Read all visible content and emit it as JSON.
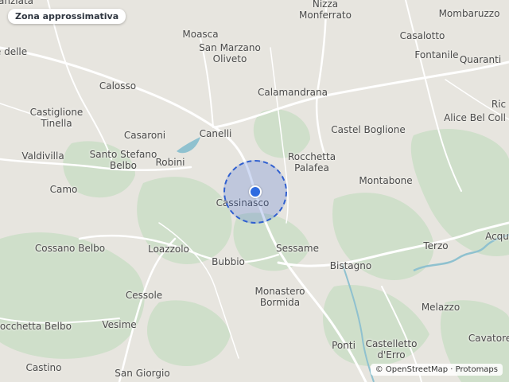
{
  "map": {
    "badge_label": "Zona approssimativa",
    "attribution": "© OpenStreetMap · Protomaps",
    "colors": {
      "land": "#e7e5df",
      "forest": "#c9dcc4",
      "road": "#ffffff",
      "water": "#8fc1cf",
      "marker": "#2f6be0",
      "radius_fill": "rgba(70,110,210,0.25)",
      "radius_stroke": "#2f5fd0"
    },
    "places": [
      {
        "name": "Nizza\nMonferrato"
      },
      {
        "name": "Mombaruzzo"
      },
      {
        "name": "Moasca"
      },
      {
        "name": "San Marzano\nOliveto"
      },
      {
        "name": "Casalotto"
      },
      {
        "name": "Fontanile"
      },
      {
        "name": "Quaranti"
      },
      {
        "name": "Calosso"
      },
      {
        "name": "Calamandrana"
      },
      {
        "name": "Castiglione\nTinella"
      },
      {
        "name": "Ric"
      },
      {
        "name": "Alice Bel Coll"
      },
      {
        "name": "Casaroni"
      },
      {
        "name": "Canelli"
      },
      {
        "name": "Castel Boglione"
      },
      {
        "name": "Valdivilla"
      },
      {
        "name": "Santo Stefano\nBelbo"
      },
      {
        "name": "Robini"
      },
      {
        "name": "Rocchetta\nPalafea"
      },
      {
        "name": "Camo"
      },
      {
        "name": "Montabone"
      },
      {
        "name": "Cassinasco"
      },
      {
        "name": "Cossano Belbo"
      },
      {
        "name": "Loazzolo"
      },
      {
        "name": "Sessame"
      },
      {
        "name": "Terzo"
      },
      {
        "name": "Acqu"
      },
      {
        "name": "Bubbio"
      },
      {
        "name": "Bistagno"
      },
      {
        "name": "Monastero\nBormida"
      },
      {
        "name": "Cessole"
      },
      {
        "name": "Melazzo"
      },
      {
        "name": "Rocchetta Belbo"
      },
      {
        "name": "Vesime"
      },
      {
        "name": "Cavatore"
      },
      {
        "name": "Ponti"
      },
      {
        "name": "Castelletto\nd'Erro"
      },
      {
        "name": "Castino"
      },
      {
        "name": "San Giorgio"
      },
      {
        "name": "e delle"
      },
      {
        "name": "anziata"
      }
    ]
  }
}
